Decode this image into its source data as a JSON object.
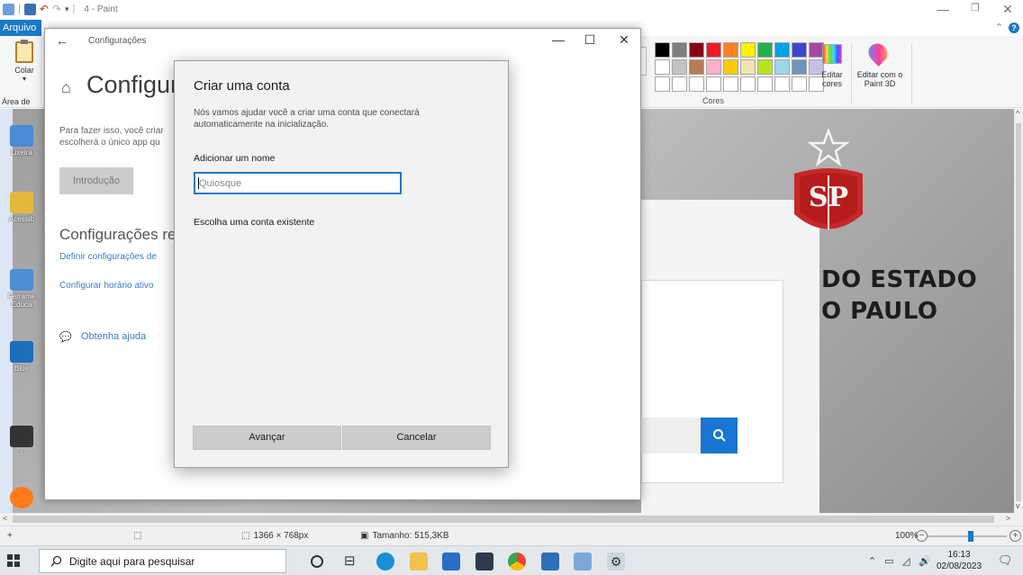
{
  "paint": {
    "title": "4 - Paint",
    "tab_arquivo": "Arquivo",
    "ribbon": {
      "colar": "Colar",
      "area_label": "Área de",
      "editar_cores": "Editar cores",
      "editar_paint3d": "Editar com o Paint 3D",
      "cores_label": "Cores"
    },
    "palette_row1": [
      "#000000",
      "#7f7f7f",
      "#880015",
      "#ed1c24",
      "#ff7f27",
      "#fff200",
      "#22b14c",
      "#00a2e8",
      "#3f48cc",
      "#a349a4"
    ],
    "palette_row2": [
      "#ffffff",
      "#c3c3c3",
      "#b97a57",
      "#ffaec9",
      "#ffc90e",
      "#efe4b0",
      "#b5e61d",
      "#99d9ea",
      "#7092be",
      "#c8bfe7"
    ],
    "canvas_text": {
      "line1": "DO ESTADO",
      "line2": "O PAULO",
      "emblem": "SP"
    },
    "desktop_icons": [
      "Lixeira",
      "Acessib",
      "Ferrame Educa",
      "Blue",
      "I"
    ],
    "status": {
      "dimensions": "1366 × 768px",
      "size": "Tamanho: 515,3KB",
      "zoom": "100%",
      "zoom_fraction": 0.55
    }
  },
  "settings": {
    "title": "Configurações",
    "heading": "Configura",
    "description": "Para fazer isso, você criar escolherá o único app qu",
    "intro_button": "Introdução",
    "related_heading": "Configurações rel",
    "link1": "Definir configurações de",
    "link2": "Configurar horário ativo",
    "help_link": "Obtenha ajuda",
    "controls": {
      "minimize": "—",
      "maximize": "☐",
      "close": "✕"
    }
  },
  "dialog": {
    "title": "Criar uma conta",
    "description": "Nós vamos ajudar você a criar uma conta que conectará automaticamente na inicialização.",
    "name_label": "Adicionar um nome",
    "name_placeholder": "Quiosque",
    "name_value": "",
    "existing_account": "Escolha uma conta existente",
    "next_button": "Avançar",
    "cancel_button": "Cancelar"
  },
  "taskbar": {
    "search_placeholder": "Digite aqui para pesquisar",
    "time": "16:13",
    "date": "02/08/2023"
  },
  "colors": {
    "accent": "#1979ca",
    "search_blue": "#1976d2"
  }
}
